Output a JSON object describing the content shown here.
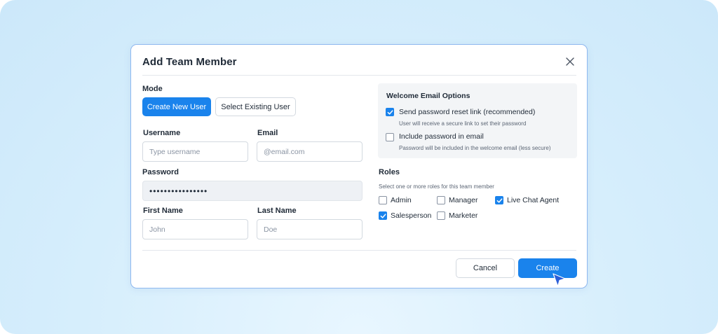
{
  "modal": {
    "title": "Add Team Member",
    "close_icon": "close-icon"
  },
  "mode": {
    "label": "Mode",
    "options": [
      "Create New User",
      "Select Existing User"
    ],
    "selected": "Create New User"
  },
  "fields": {
    "username": {
      "label": "Username",
      "placeholder": "Type username",
      "value": ""
    },
    "email": {
      "label": "Email",
      "placeholder": "@email.com",
      "value": ""
    },
    "password": {
      "label": "Password",
      "value": "••••••••••••••••"
    },
    "first_name": {
      "label": "First Name",
      "placeholder": "John",
      "value": ""
    },
    "last_name": {
      "label": "Last Name",
      "placeholder": "Doe",
      "value": ""
    }
  },
  "welcome_email": {
    "title": "Welcome Email Options",
    "options": [
      {
        "label": "Send password reset link (recommended)",
        "description": "User will receive a secure link to set their password",
        "checked": true
      },
      {
        "label": "Include password in email",
        "description": "Password will be included in the welcome email (less secure)",
        "checked": false
      }
    ]
  },
  "roles": {
    "label": "Roles",
    "hint": "Select one or more roles for this team member",
    "items": [
      {
        "label": "Admin",
        "checked": false
      },
      {
        "label": "Manager",
        "checked": false
      },
      {
        "label": "Live Chat Agent",
        "checked": true
      },
      {
        "label": "Salesperson",
        "checked": true
      },
      {
        "label": "Marketer",
        "checked": false
      }
    ]
  },
  "footer": {
    "cancel_label": "Cancel",
    "create_label": "Create"
  },
  "colors": {
    "accent": "#1a83ec",
    "background": "#d6eefc"
  }
}
